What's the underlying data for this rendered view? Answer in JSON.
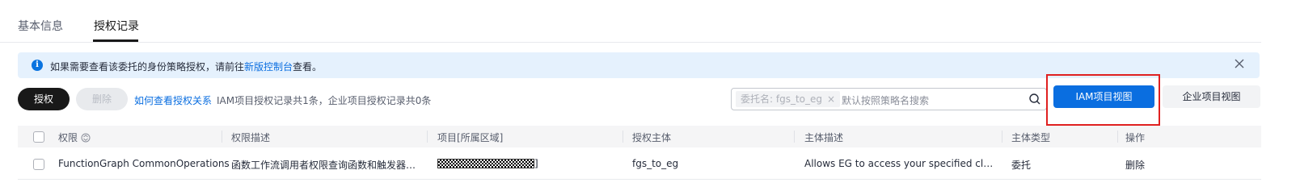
{
  "tabs": [
    {
      "label": "基本信息"
    },
    {
      "label": "授权记录"
    }
  ],
  "alert": {
    "text_before": "如果需要查看该委托的身份策略授权，请前往",
    "link": "新版控制台",
    "text_after": "查看。"
  },
  "toolbar": {
    "grant_label": "授权",
    "delete_label": "删除",
    "help_link": "如何查看授权关系",
    "count_text": "IAM项目授权记录共1条，企业项目授权记录共0条"
  },
  "search": {
    "filter_tag": "委托名: fgs_to_eg",
    "placeholder": "默认按照策略名搜索"
  },
  "view_buttons": {
    "iam": "IAM项目视图",
    "enterprise": "企业项目视图"
  },
  "table": {
    "headers": [
      "权限",
      "权限描述",
      "项目[所属区域]",
      "授权主体",
      "主体描述",
      "主体类型",
      "操作"
    ],
    "rows": [
      {
        "permission": "FunctionGraph CommonOperations",
        "description": "函数工作流调用者权限查询函数和触发器，...",
        "project_suffix": "]",
        "principal": "fgs_to_eg",
        "principal_desc": "Allows EG to access your specified cloud s...",
        "principal_type": "委托",
        "action": "删除"
      }
    ]
  },
  "colors": {
    "accent": "#0a6ee0",
    "primary_dark": "#191919",
    "alert_bg": "#e5f1fd",
    "highlight": "#e02020"
  }
}
